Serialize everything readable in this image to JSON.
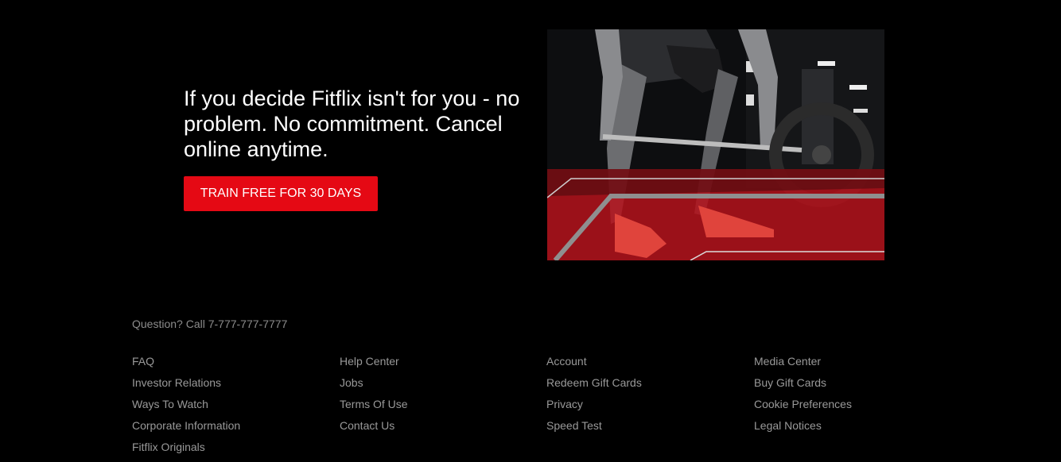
{
  "hero": {
    "headline": "If you decide Fitflix isn't for you - no problem. No commitment. Cancel online anytime.",
    "cta_label": "TRAIN FREE FOR 30 DAYS"
  },
  "colors": {
    "background": "#000000",
    "accent": "#e50914",
    "footer_link": "#999999"
  },
  "footer": {
    "question": "Question? Call 7-777-777-7777",
    "columns": [
      [
        "FAQ",
        "Investor Relations",
        "Ways To Watch",
        "Corporate Information",
        "Fitflix Originals"
      ],
      [
        "Help Center",
        "Jobs",
        "Terms Of Use",
        "Contact Us"
      ],
      [
        "Account",
        "Redeem Gift Cards",
        "Privacy",
        "Speed Test"
      ],
      [
        "Media Center",
        "Buy Gift Cards",
        "Cookie Preferences",
        "Legal Notices"
      ]
    ]
  }
}
